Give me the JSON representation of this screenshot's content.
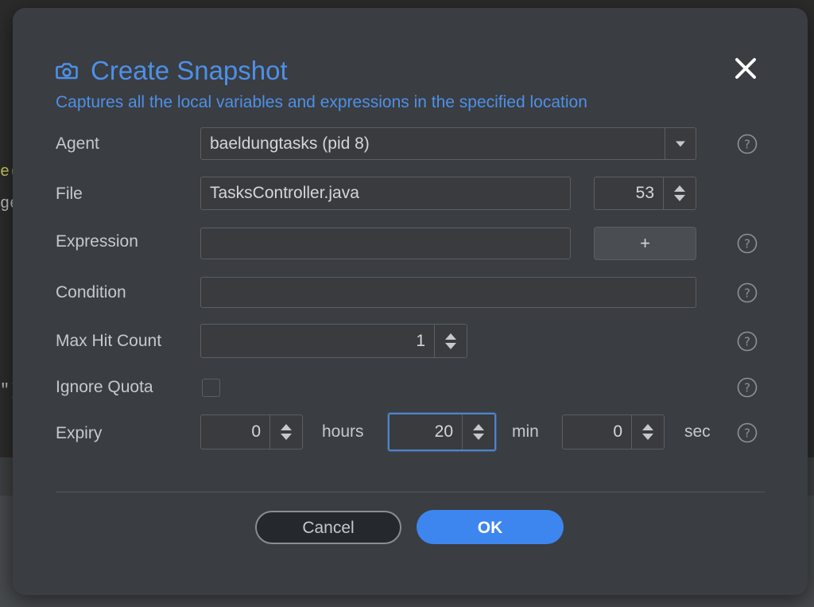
{
  "background": {
    "code_fragments": [
      "e(",
      "ge",
      "\")"
    ]
  },
  "dialog": {
    "title": "Create Snapshot",
    "subtitle": "Captures all the local variables and expressions in the specified location",
    "title_icon": "camera-icon",
    "close_icon": "close-icon",
    "accent_color": "#4e90e8"
  },
  "form": {
    "agent": {
      "label": "Agent",
      "value": "baeldungtasks (pid 8)"
    },
    "file": {
      "label": "File",
      "value": "TasksController.java",
      "line": "53"
    },
    "expression": {
      "label": "Expression",
      "value": "",
      "add_label": "+"
    },
    "condition": {
      "label": "Condition",
      "value": ""
    },
    "max_hit_count": {
      "label": "Max Hit Count",
      "value": "1"
    },
    "ignore_quota": {
      "label": "Ignore Quota",
      "checked": false
    },
    "expiry": {
      "label": "Expiry",
      "hours": "0",
      "hours_unit": "hours",
      "minutes": "20",
      "minutes_unit": "min",
      "seconds": "0",
      "seconds_unit": "sec"
    }
  },
  "buttons": {
    "cancel": "Cancel",
    "ok": "OK",
    "ok_color": "#3d86f0"
  }
}
